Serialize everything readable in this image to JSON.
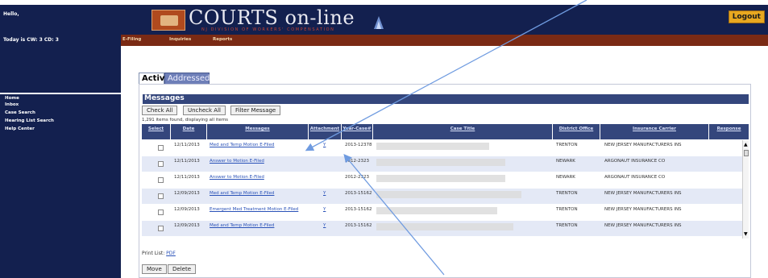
{
  "header": {
    "greeting": "Hello,",
    "logo_title": "COURTS on-line",
    "logo_subtitle": "NJ DIVISION OF WORKERS' COMPENSATION",
    "logout_label": "Logout"
  },
  "status": {
    "today": "Today is CW: 3 CD: 3"
  },
  "nav": {
    "items": [
      "E-Filing",
      "Inquiries",
      "Reports"
    ]
  },
  "sidebar": {
    "items": [
      "Home",
      "Inbox",
      "Case Search",
      "Hearing List Search",
      "Help Center"
    ]
  },
  "tabs": [
    {
      "label": "Active"
    },
    {
      "label": "Addressed"
    }
  ],
  "panel": {
    "title": "Messages",
    "buttons": {
      "check_all": "Check All",
      "uncheck_all": "Uncheck All",
      "filter": "Filter Message"
    },
    "count_text": "1,291 items found, displaying all items",
    "columns": [
      "Select",
      "Date",
      "Messages",
      "Attachment",
      "Year-Case#",
      "Case Title",
      "District Office",
      "Insurance Carrier",
      "Response"
    ],
    "rows": [
      {
        "date": "12/11/2013",
        "message": "Med and Temp Motion E-Filed",
        "attachment": "Y",
        "year_case": "2013-12378",
        "office": "TRENTON",
        "carrier": "NEW JERSEY MANUFACTURERS INS"
      },
      {
        "date": "12/11/2013",
        "message": "Answer to Motion E-Filed",
        "attachment": "",
        "year_case": "2012-2323",
        "office": "NEWARK",
        "carrier": "ARGONAUT INSURANCE CO"
      },
      {
        "date": "12/11/2013",
        "message": "Answer to Motion E-Filed",
        "attachment": "",
        "year_case": "2012-2323",
        "office": "NEWARK",
        "carrier": "ARGONAUT INSURANCE CO"
      },
      {
        "date": "12/09/2013",
        "message": "Med and Temp Motion E-Filed",
        "attachment": "Y",
        "year_case": "2013-15162",
        "office": "TRENTON",
        "carrier": "NEW JERSEY MANUFACTURERS INS"
      },
      {
        "date": "12/09/2013",
        "message": "Emergent Med Treatment Motion E-Filed",
        "attachment": "Y",
        "year_case": "2013-15162",
        "office": "TRENTON",
        "carrier": "NEW JERSEY MANUFACTURERS INS"
      },
      {
        "date": "12/09/2013",
        "message": "Med and Temp Motion E-Filed",
        "attachment": "Y",
        "year_case": "2013-15162",
        "office": "TRENTON",
        "carrier": "NEW JERSEY MANUFACTURERS INS"
      }
    ],
    "print_label": "Print List:",
    "print_link": "PDF",
    "bottom_buttons": {
      "move": "Move",
      "delete": "Delete"
    }
  },
  "colors": {
    "header_bg": "#13204f",
    "nav_bg": "#7a2a14",
    "table_header": "#34467c",
    "logout_bg": "#e8a820",
    "arrow": "#6f9be0"
  }
}
